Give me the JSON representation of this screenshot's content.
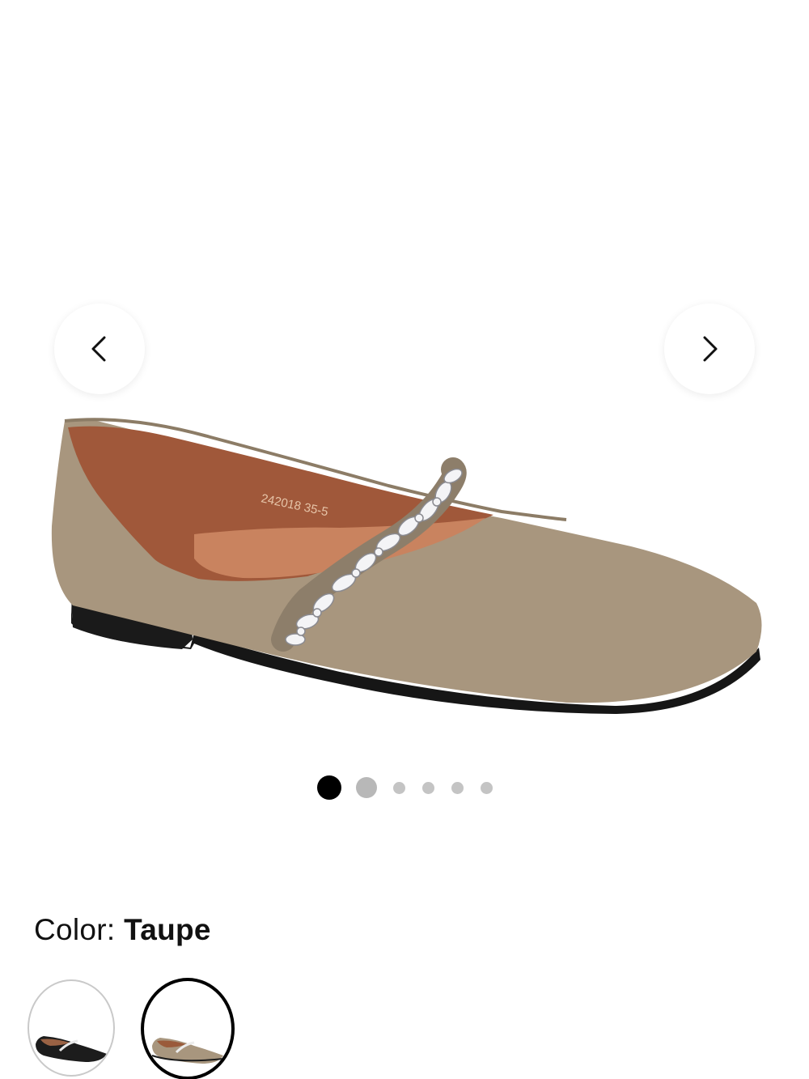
{
  "gallery": {
    "image_alt": "Taupe pointed-toe flat with crystal strap",
    "insole_print": "242018 35-5",
    "prev_icon": "chevron-left-icon",
    "next_icon": "chevron-right-icon",
    "slide_count": 6,
    "active_slide": 1
  },
  "color": {
    "label": "Color:",
    "value": "Taupe"
  },
  "swatches": [
    {
      "name": "Black",
      "selected": false,
      "color": "#1c1c1c"
    },
    {
      "name": "Taupe",
      "selected": true,
      "color": "#a8967e"
    }
  ],
  "colors": {
    "taupe": "#a8967e",
    "lining": "#a0583a",
    "sole": "#151515",
    "active_dot": "#000000",
    "inactive_dot": "#c4c4c4"
  }
}
